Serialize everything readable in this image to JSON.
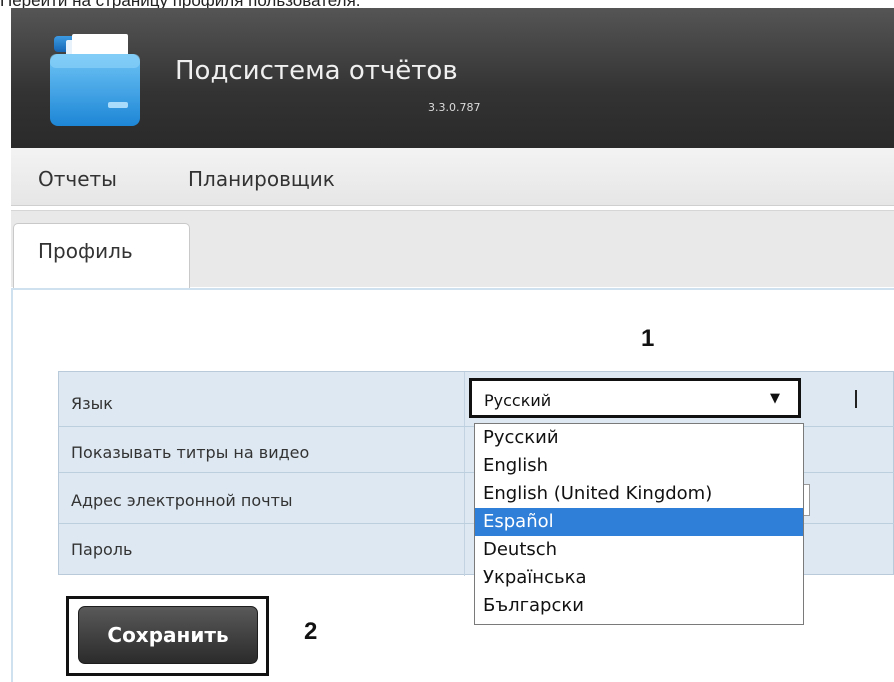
{
  "caption": "Перейти на страницу профиля пользователя.",
  "header": {
    "title": "Подсистема отчётов",
    "version": "3.3.0.787",
    "logo_icon": "folder-icon"
  },
  "nav": {
    "items": [
      {
        "label": "Отчеты"
      },
      {
        "label": "Планировщик"
      }
    ]
  },
  "tabs": {
    "items": [
      {
        "label": "Профиль",
        "active": true
      }
    ]
  },
  "settings": {
    "rows": [
      {
        "label": "Язык"
      },
      {
        "label": "Показывать титры на видео"
      },
      {
        "label": "Адрес электронной почты"
      },
      {
        "label": "Пароль"
      }
    ],
    "language_select": {
      "value": "Русский",
      "arrow": "▼",
      "options": [
        "Русский",
        "English",
        "English (United Kingdom)",
        "Español",
        "Deutsch",
        "Українська",
        "Български"
      ],
      "highlighted": "Español"
    }
  },
  "annotations": {
    "one": "1",
    "two": "2"
  },
  "save_button": {
    "label": "Сохранить"
  },
  "colors": {
    "header_bg": "#333333",
    "highlight": "#2f7fd8",
    "table_bg": "#dde8f2",
    "button_bg": "#3a3a3a"
  }
}
